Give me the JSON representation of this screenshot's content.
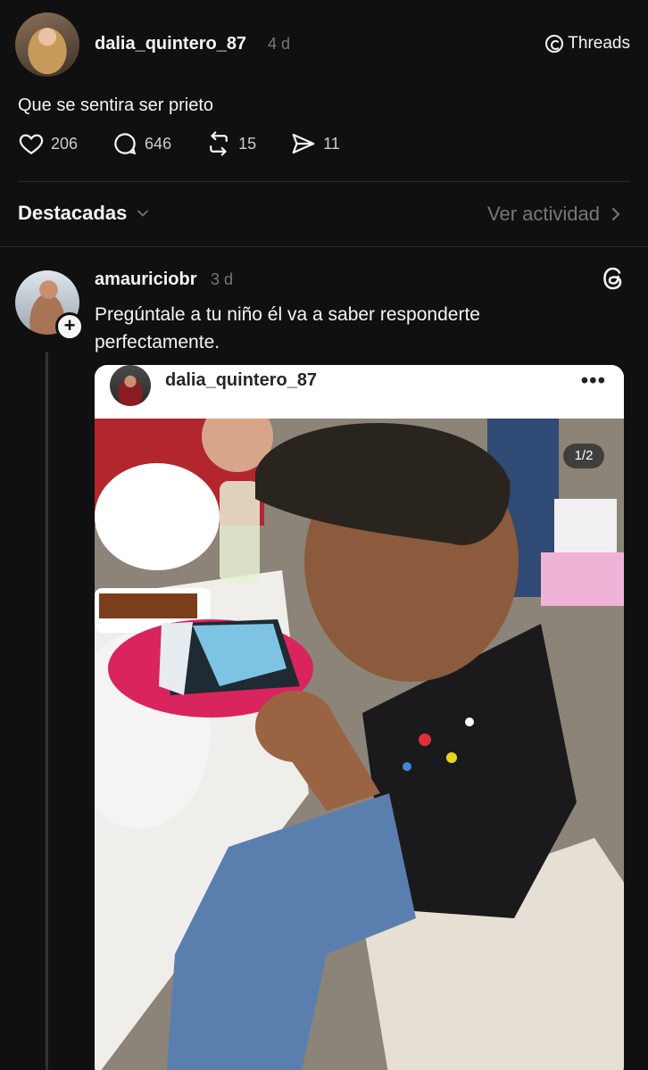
{
  "post": {
    "username": "dalia_quintero_87",
    "time": "4 d",
    "badge": "Threads",
    "text": "Que se sentira ser prieto",
    "likes": "206",
    "comments": "646",
    "reposts": "15",
    "shares": "11"
  },
  "tabs": {
    "featured": "Destacadas",
    "activity": "Ver actividad"
  },
  "reply": {
    "username": "amauriciobr",
    "time": "3 d",
    "text": "Pregúntale a tu niño él va a saber responderte perfectamente.",
    "embed": {
      "username": "dalia_quintero_87",
      "more": "•••",
      "counter": "1/2"
    }
  },
  "colors": {
    "background": "#101010",
    "text": "#f3f5f7",
    "muted": "#777777"
  }
}
